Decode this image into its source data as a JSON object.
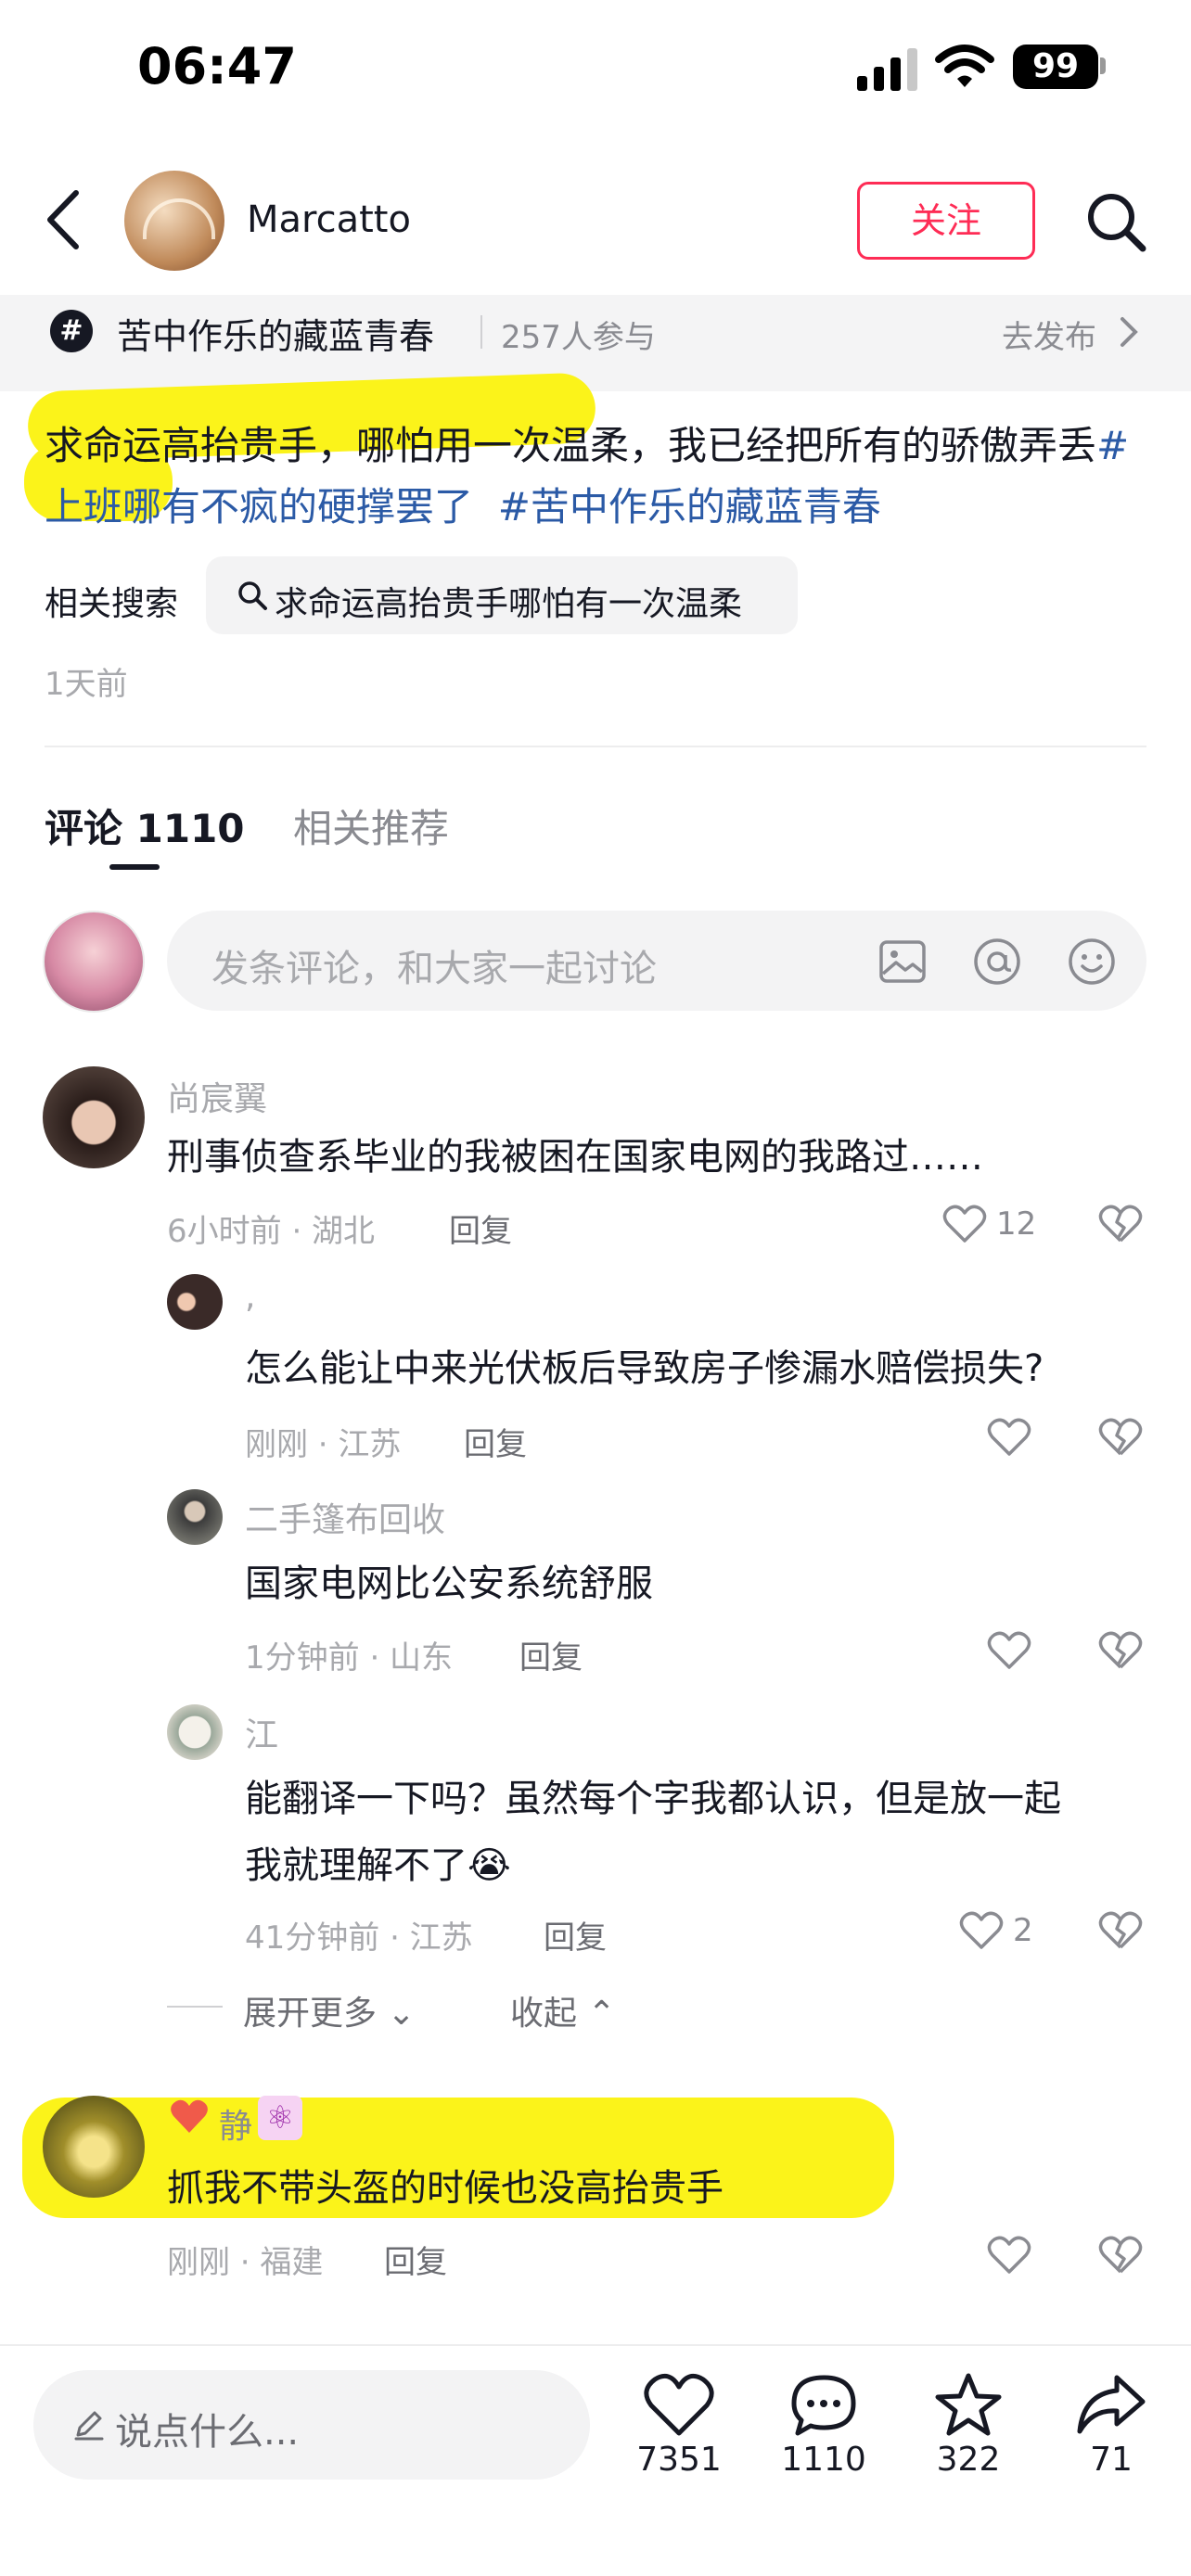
{
  "status_bar": {
    "time": "06:47",
    "battery": "99"
  },
  "header": {
    "username": "Marcatto",
    "follow_label": "关注"
  },
  "topic": {
    "hash": "#",
    "name": "苦中作乐的藏蓝青春",
    "participants": "257人参与",
    "action": "去发布"
  },
  "post": {
    "text": "求命运高抬贵手，哪怕用一次温柔，我已经把所有的骄傲弄丢",
    "tags": [
      "#上班哪有不疯的硬撑罢了",
      "#苦中作乐的藏蓝青春"
    ],
    "related_label": "相关搜索",
    "related_query": "求命运高抬贵手哪怕有一次温柔",
    "time_ago": "1天前"
  },
  "tabs": {
    "comments": "评论 1110",
    "related": "相关推荐"
  },
  "comment_input": {
    "placeholder": "发条评论，和大家一起讨论"
  },
  "comments": [
    {
      "name": "尚宸翼",
      "text": "刑事侦查系毕业的我被困在国家电网的我路过……",
      "meta": "6小时前 · 湖北",
      "reply": "回复",
      "likes": "12"
    },
    {
      "name": ",",
      "text": "怎么能让中来光伏板后导致房子惨漏水赔偿损失?",
      "meta": "刚刚 · 江苏",
      "reply": "回复",
      "likes": ""
    },
    {
      "name": "二手篷布回收",
      "text": "国家电网比公安系统舒服",
      "meta": "1分钟前 · 山东",
      "reply": "回复",
      "likes": ""
    },
    {
      "name": "江",
      "text_line1": "能翻译一下吗？虽然每个字我都认识，但是放一起",
      "text_line2": "我就理解不了",
      "emoji": "😭",
      "meta": "41分钟前 · 江苏",
      "reply": "回复",
      "likes": "2"
    },
    {
      "name": "静",
      "text": "抓我不带头盔的时候也没高抬贵手",
      "meta": "刚刚 · 福建",
      "reply": "回复",
      "likes": ""
    }
  ],
  "expand": {
    "more": "展开更多",
    "collapse": "收起"
  },
  "bottom_bar": {
    "placeholder": "说点什么...",
    "likes": "7351",
    "comments": "1110",
    "favorites": "322",
    "shares": "71"
  },
  "colors": {
    "accent": "#fe2c55",
    "tag": "#2b5aa6",
    "highlight": "#fbf31a"
  }
}
